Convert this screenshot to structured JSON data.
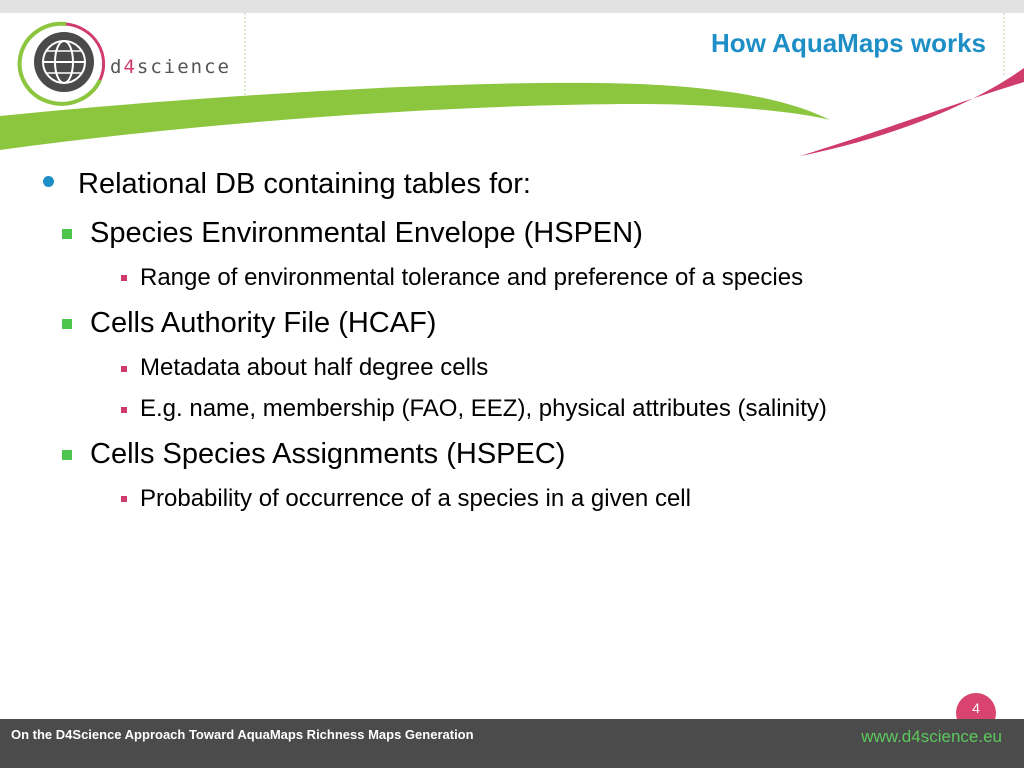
{
  "header": {
    "title": "How AquaMaps works",
    "logo_text_prefix": "d",
    "logo_text_accent": "4",
    "logo_text_suffix": "science"
  },
  "content": {
    "items": [
      {
        "level": 1,
        "text": "Relational DB containing tables for:"
      },
      {
        "level": 2,
        "text": "Species Environmental Envelope (HSPEN)"
      },
      {
        "level": 3,
        "text": "Range of environmental tolerance and preference of a species"
      },
      {
        "level": 2,
        "text": "Cells Authority File (HCAF)"
      },
      {
        "level": 3,
        "text": "Metadata about half degree cells"
      },
      {
        "level": 3,
        "text": "E.g. name, membership (FAO, EEZ), physical attributes (salinity)"
      },
      {
        "level": 2,
        "text": "Cells Species Assignments (HSPEC)"
      },
      {
        "level": 3,
        "text": "Probability of occurrence of a species in a given cell"
      }
    ]
  },
  "page_number": "4",
  "footer": {
    "title": "On the D4Science Approach Toward AquaMaps Richness Maps Generation",
    "url": "www.d4science.eu"
  },
  "colors": {
    "title": "#1e8fc6",
    "green_swoosh": "#8cc63f",
    "pink_swoosh": "#cf3b6b",
    "footer_bg": "#4b4b4b",
    "footer_url": "#5cc85c",
    "level1_bullet": "#1e8fc6",
    "level2_bullet": "#4ec64e",
    "level3_bullet": "#cf3b6b"
  }
}
